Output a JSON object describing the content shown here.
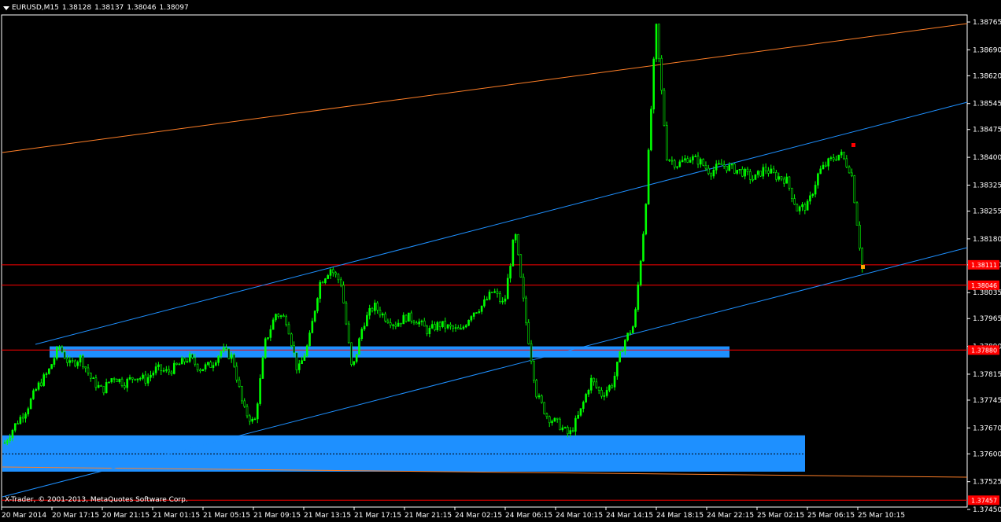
{
  "header": {
    "symbol": "EURUSD,M15",
    "open": "1.38128",
    "high": "1.38137",
    "low": "1.38046",
    "close": "1.38097"
  },
  "footer": {
    "copyright": "X-Trader, © 2001-2013, MetaQuotes Software Corp."
  },
  "colors": {
    "background": "#000000",
    "candles": "#00ff00",
    "frame": "#ffffff",
    "channel": "#1e90ff",
    "outer_channel": "#ff7f27",
    "level_line": "#ff0000",
    "zone": "#1e90ff",
    "price_label_bg": "#ff0000"
  },
  "chart_data": {
    "type": "candlestick",
    "title": "EURUSD,M15",
    "ylim": [
      1.37465,
      1.38765
    ],
    "y_ticks": [
      "1.38765",
      "1.38690",
      "1.38620",
      "1.38545",
      "1.38475",
      "1.38400",
      "1.38325",
      "1.38255",
      "1.38180",
      "1.38110",
      "1.38035",
      "1.37965",
      "1.37890",
      "1.37815",
      "1.37745",
      "1.37670",
      "1.37600",
      "1.37525",
      "1.37450"
    ],
    "x_ticks": [
      "20 Mar 2014",
      "20 Mar 17:15",
      "20 Mar 21:15",
      "21 Mar 01:15",
      "21 Mar 05:15",
      "21 Mar 09:15",
      "21 Mar 13:15",
      "21 Mar 17:15",
      "21 Mar 21:15",
      "24 Mar 02:15",
      "24 Mar 06:15",
      "24 Mar 10:15",
      "24 Mar 14:15",
      "24 Mar 18:15",
      "24 Mar 22:15",
      "25 Mar 02:15",
      "25 Mar 06:15",
      "25 Mar 10:15"
    ],
    "price_path": [
      [
        0,
        1.3763
      ],
      [
        1,
        1.3768
      ],
      [
        2,
        1.3772
      ],
      [
        3,
        1.3778
      ],
      [
        4,
        1.3782
      ],
      [
        5,
        1.3789
      ],
      [
        6,
        1.3784
      ],
      [
        7,
        1.3786
      ],
      [
        8,
        1.378
      ],
      [
        9,
        1.3777
      ],
      [
        10,
        1.3781
      ],
      [
        11,
        1.3779
      ],
      [
        12,
        1.3781
      ],
      [
        13,
        1.378
      ],
      [
        14,
        1.3783
      ],
      [
        15,
        1.3782
      ],
      [
        16,
        1.3784
      ],
      [
        17,
        1.3786
      ],
      [
        18,
        1.3783
      ],
      [
        19,
        1.3784
      ],
      [
        20,
        1.3788
      ],
      [
        21,
        1.3786
      ],
      [
        22,
        1.3772
      ],
      [
        23,
        1.3768
      ],
      [
        24,
        1.379
      ],
      [
        25,
        1.3798
      ],
      [
        26,
        1.3796
      ],
      [
        27,
        1.3782
      ],
      [
        28,
        1.379
      ],
      [
        29,
        1.3806
      ],
      [
        30,
        1.381
      ],
      [
        31,
        1.3806
      ],
      [
        32,
        1.3782
      ],
      [
        33,
        1.3795
      ],
      [
        34,
        1.38
      ],
      [
        35,
        1.3797
      ],
      [
        36,
        1.3795
      ],
      [
        37,
        1.3797
      ],
      [
        38,
        1.3796
      ],
      [
        39,
        1.3793
      ],
      [
        40,
        1.3795
      ],
      [
        41,
        1.3794
      ],
      [
        42,
        1.3793
      ],
      [
        43,
        1.3798
      ],
      [
        44,
        1.38
      ],
      [
        45,
        1.3804
      ],
      [
        46,
        1.38
      ],
      [
        47,
        1.382
      ],
      [
        48,
        1.3796
      ],
      [
        49,
        1.3776
      ],
      [
        50,
        1.377
      ],
      [
        51,
        1.3768
      ],
      [
        52,
        1.3765
      ],
      [
        53,
        1.3771
      ],
      [
        54,
        1.378
      ],
      [
        55,
        1.3776
      ],
      [
        56,
        1.3779
      ],
      [
        57,
        1.379
      ],
      [
        58,
        1.3795
      ],
      [
        59,
        1.3825
      ],
      [
        60,
        1.3876
      ],
      [
        61,
        1.384
      ],
      [
        62,
        1.3838
      ],
      [
        63,
        1.384
      ],
      [
        64,
        1.3839
      ],
      [
        65,
        1.3836
      ],
      [
        66,
        1.3838
      ],
      [
        67,
        1.3837
      ],
      [
        68,
        1.3836
      ],
      [
        69,
        1.3834
      ],
      [
        70,
        1.3837
      ],
      [
        71,
        1.3835
      ],
      [
        72,
        1.3834
      ],
      [
        73,
        1.3826
      ],
      [
        74,
        1.3827
      ],
      [
        75,
        1.3836
      ],
      [
        76,
        1.3839
      ],
      [
        77,
        1.3841
      ],
      [
        78,
        1.3836
      ],
      [
        79,
        1.381
      ]
    ],
    "horizontal_levels": [
      {
        "price": 1.3811,
        "label": "1.38111"
      },
      {
        "price": 1.38055,
        "label": "1.38046"
      },
      {
        "price": 1.3788,
        "label": "1.37880"
      },
      {
        "price": 1.37475,
        "label": "1.37457"
      }
    ],
    "zones": [
      {
        "from": 1.3786,
        "to": 1.3789
      },
      {
        "from": 1.37552,
        "to": 1.3765
      }
    ],
    "dashed_level": 1.376,
    "grid": false,
    "legend": "none"
  }
}
